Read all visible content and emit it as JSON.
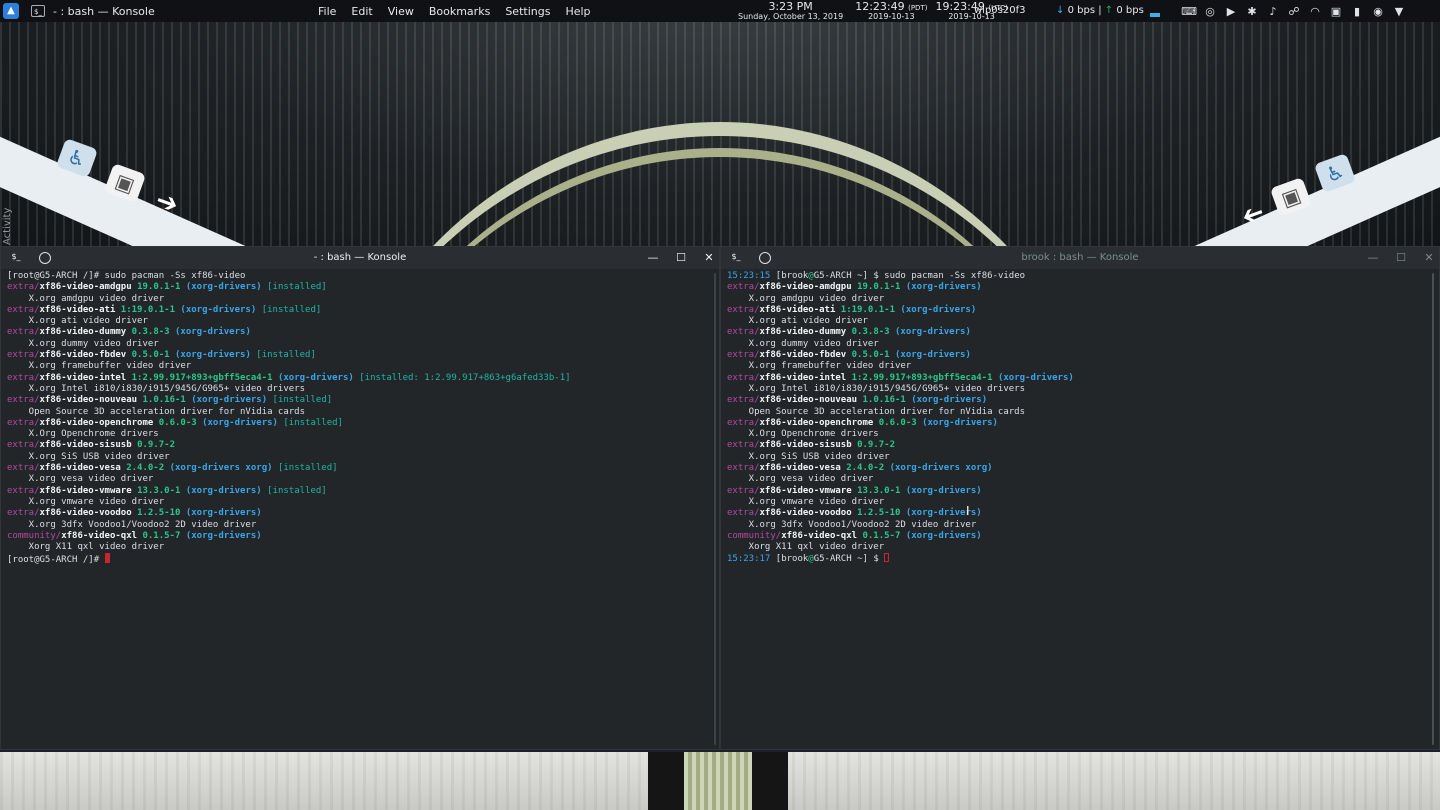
{
  "top_panel": {
    "launcher_icon": "app-launcher-icon",
    "task_title": "- : bash — Konsole",
    "menu": [
      "File",
      "Edit",
      "View",
      "Bookmarks",
      "Settings",
      "Help"
    ],
    "clock_local": {
      "time": "3:23 PM",
      "date": "Sunday, October 13, 2019"
    },
    "clock_pdt": {
      "time": "12:23:49",
      "tz": "(PDT)",
      "date": "2019-10-13"
    },
    "clock_utc": {
      "time": "19:23:49",
      "tz": "(UTC)",
      "date": "2019-10-13"
    },
    "network_interface": "wlp0s20f3",
    "net_down_arrow": "↓",
    "net_down": "0 bps",
    "net_sep": "|",
    "net_up_arrow": "↑",
    "net_up": "0 bps",
    "tray_icons": [
      "keyboard-icon",
      "clipboard-icon",
      "media-player-icon",
      "bluetooth-icon",
      "volume-icon",
      "kde-connect-icon",
      "wifi-icon",
      "lock-icon",
      "battery-icon",
      "notifications-icon",
      "arrow-down-icon"
    ]
  },
  "activity_label": "Activity",
  "left_window": {
    "title": "- : bash — Konsole",
    "lines": [
      [
        [
          "t-plain",
          "[root@G5-ARCH /]# sudo pacman -Ss xf86-video"
        ]
      ],
      [
        [
          "t-repo",
          "extra/"
        ],
        [
          "t-pkg",
          "xf86-video-amdgpu"
        ],
        [
          "t-plain",
          " "
        ],
        [
          "t-ver",
          "19.0.1-1"
        ],
        [
          "t-plain",
          " "
        ],
        [
          "t-grp",
          "(xorg-drivers)"
        ],
        [
          "t-plain",
          " "
        ],
        [
          "t-inst",
          "[installed]"
        ]
      ],
      [
        [
          "t-plain",
          "    X.org amdgpu video driver"
        ]
      ],
      [
        [
          "t-repo",
          "extra/"
        ],
        [
          "t-pkg",
          "xf86-video-ati"
        ],
        [
          "t-plain",
          " "
        ],
        [
          "t-ver",
          "1:19.0.1-1"
        ],
        [
          "t-plain",
          " "
        ],
        [
          "t-grp",
          "(xorg-drivers)"
        ],
        [
          "t-plain",
          " "
        ],
        [
          "t-inst",
          "[installed]"
        ]
      ],
      [
        [
          "t-plain",
          "    X.org ati video driver"
        ]
      ],
      [
        [
          "t-repo",
          "extra/"
        ],
        [
          "t-pkg",
          "xf86-video-dummy"
        ],
        [
          "t-plain",
          " "
        ],
        [
          "t-ver",
          "0.3.8-3"
        ],
        [
          "t-plain",
          " "
        ],
        [
          "t-grp",
          "(xorg-drivers)"
        ]
      ],
      [
        [
          "t-plain",
          "    X.org dummy video driver"
        ]
      ],
      [
        [
          "t-repo",
          "extra/"
        ],
        [
          "t-pkg",
          "xf86-video-fbdev"
        ],
        [
          "t-plain",
          " "
        ],
        [
          "t-ver",
          "0.5.0-1"
        ],
        [
          "t-plain",
          " "
        ],
        [
          "t-grp",
          "(xorg-drivers)"
        ],
        [
          "t-plain",
          " "
        ],
        [
          "t-inst",
          "[installed]"
        ]
      ],
      [
        [
          "t-plain",
          "    X.org framebuffer video driver"
        ]
      ],
      [
        [
          "t-repo",
          "extra/"
        ],
        [
          "t-pkg",
          "xf86-video-intel"
        ],
        [
          "t-plain",
          " "
        ],
        [
          "t-ver",
          "1:2.99.917+893+gbff5eca4-1"
        ],
        [
          "t-plain",
          " "
        ],
        [
          "t-grp",
          "(xorg-drivers)"
        ],
        [
          "t-plain",
          " "
        ],
        [
          "t-inst",
          "[installed: 1:2.99.917+863+g6afed33b-1]"
        ]
      ],
      [
        [
          "t-plain",
          "    X.org Intel i810/i830/i915/945G/G965+ video drivers"
        ]
      ],
      [
        [
          "t-repo",
          "extra/"
        ],
        [
          "t-pkg",
          "xf86-video-nouveau"
        ],
        [
          "t-plain",
          " "
        ],
        [
          "t-ver",
          "1.0.16-1"
        ],
        [
          "t-plain",
          " "
        ],
        [
          "t-grp",
          "(xorg-drivers)"
        ],
        [
          "t-plain",
          " "
        ],
        [
          "t-inst",
          "[installed]"
        ]
      ],
      [
        [
          "t-plain",
          "    Open Source 3D acceleration driver for nVidia cards"
        ]
      ],
      [
        [
          "t-repo",
          "extra/"
        ],
        [
          "t-pkg",
          "xf86-video-openchrome"
        ],
        [
          "t-plain",
          " "
        ],
        [
          "t-ver",
          "0.6.0-3"
        ],
        [
          "t-plain",
          " "
        ],
        [
          "t-grp",
          "(xorg-drivers)"
        ],
        [
          "t-plain",
          " "
        ],
        [
          "t-inst",
          "[installed]"
        ]
      ],
      [
        [
          "t-plain",
          "    X.Org Openchrome drivers"
        ]
      ],
      [
        [
          "t-repo",
          "extra/"
        ],
        [
          "t-pkg",
          "xf86-video-sisusb"
        ],
        [
          "t-plain",
          " "
        ],
        [
          "t-ver",
          "0.9.7-2"
        ]
      ],
      [
        [
          "t-plain",
          "    X.org SiS USB video driver"
        ]
      ],
      [
        [
          "t-repo",
          "extra/"
        ],
        [
          "t-pkg",
          "xf86-video-vesa"
        ],
        [
          "t-plain",
          " "
        ],
        [
          "t-ver",
          "2.4.0-2"
        ],
        [
          "t-plain",
          " "
        ],
        [
          "t-grp",
          "(xorg-drivers xorg)"
        ],
        [
          "t-plain",
          " "
        ],
        [
          "t-inst",
          "[installed]"
        ]
      ],
      [
        [
          "t-plain",
          "    X.org vesa video driver"
        ]
      ],
      [
        [
          "t-repo",
          "extra/"
        ],
        [
          "t-pkg",
          "xf86-video-vmware"
        ],
        [
          "t-plain",
          " "
        ],
        [
          "t-ver",
          "13.3.0-1"
        ],
        [
          "t-plain",
          " "
        ],
        [
          "t-grp",
          "(xorg-drivers)"
        ],
        [
          "t-plain",
          " "
        ],
        [
          "t-inst",
          "[installed]"
        ]
      ],
      [
        [
          "t-plain",
          "    X.org vmware video driver"
        ]
      ],
      [
        [
          "t-repo",
          "extra/"
        ],
        [
          "t-pkg",
          "xf86-video-voodoo"
        ],
        [
          "t-plain",
          " "
        ],
        [
          "t-ver",
          "1.2.5-10"
        ],
        [
          "t-plain",
          " "
        ],
        [
          "t-grp",
          "(xorg-drivers)"
        ]
      ],
      [
        [
          "t-plain",
          "    X.org 3dfx Voodoo1/Voodoo2 2D video driver"
        ]
      ],
      [
        [
          "t-repo-com",
          "community/"
        ],
        [
          "t-pkg",
          "xf86-video-qxl"
        ],
        [
          "t-plain",
          " "
        ],
        [
          "t-ver",
          "0.1.5-7"
        ],
        [
          "t-plain",
          " "
        ],
        [
          "t-grp",
          "(xorg-drivers)"
        ]
      ],
      [
        [
          "t-plain",
          "    Xorg X11 qxl video driver"
        ]
      ],
      [
        [
          "t-plain",
          "[root@G5-ARCH /]# "
        ],
        [
          "cursor-block",
          ""
        ]
      ]
    ]
  },
  "right_window": {
    "title": "brook : bash — Konsole",
    "lines": [
      [
        [
          "t-time",
          "15:23:15"
        ],
        [
          "t-plain",
          " [brook"
        ],
        [
          "t-at",
          "@"
        ],
        [
          "t-plain",
          "G5-ARCH ~] $ sudo pacman -Ss xf86-video"
        ]
      ],
      [
        [
          "t-repo",
          "extra/"
        ],
        [
          "t-pkg",
          "xf86-video-amdgpu"
        ],
        [
          "t-plain",
          " "
        ],
        [
          "t-ver",
          "19.0.1-1"
        ],
        [
          "t-plain",
          " "
        ],
        [
          "t-grp",
          "(xorg-drivers)"
        ]
      ],
      [
        [
          "t-plain",
          "    X.org amdgpu video driver"
        ]
      ],
      [
        [
          "t-repo",
          "extra/"
        ],
        [
          "t-pkg",
          "xf86-video-ati"
        ],
        [
          "t-plain",
          " "
        ],
        [
          "t-ver",
          "1:19.0.1-1"
        ],
        [
          "t-plain",
          " "
        ],
        [
          "t-grp",
          "(xorg-drivers)"
        ]
      ],
      [
        [
          "t-plain",
          "    X.org ati video driver"
        ]
      ],
      [
        [
          "t-repo",
          "extra/"
        ],
        [
          "t-pkg",
          "xf86-video-dummy"
        ],
        [
          "t-plain",
          " "
        ],
        [
          "t-ver",
          "0.3.8-3"
        ],
        [
          "t-plain",
          " "
        ],
        [
          "t-grp",
          "(xorg-drivers)"
        ]
      ],
      [
        [
          "t-plain",
          "    X.org dummy video driver"
        ]
      ],
      [
        [
          "t-repo",
          "extra/"
        ],
        [
          "t-pkg",
          "xf86-video-fbdev"
        ],
        [
          "t-plain",
          " "
        ],
        [
          "t-ver",
          "0.5.0-1"
        ],
        [
          "t-plain",
          " "
        ],
        [
          "t-grp",
          "(xorg-drivers)"
        ]
      ],
      [
        [
          "t-plain",
          "    X.org framebuffer video driver"
        ]
      ],
      [
        [
          "t-repo",
          "extra/"
        ],
        [
          "t-pkg",
          "xf86-video-intel"
        ],
        [
          "t-plain",
          " "
        ],
        [
          "t-ver",
          "1:2.99.917+893+gbff5eca4-1"
        ],
        [
          "t-plain",
          " "
        ],
        [
          "t-grp",
          "(xorg-drivers)"
        ]
      ],
      [
        [
          "t-plain",
          "    X.org Intel i810/i830/i915/945G/G965+ video drivers"
        ]
      ],
      [
        [
          "t-repo",
          "extra/"
        ],
        [
          "t-pkg",
          "xf86-video-nouveau"
        ],
        [
          "t-plain",
          " "
        ],
        [
          "t-ver",
          "1.0.16-1"
        ],
        [
          "t-plain",
          " "
        ],
        [
          "t-grp",
          "(xorg-drivers)"
        ]
      ],
      [
        [
          "t-plain",
          "    Open Source 3D acceleration driver for nVidia cards"
        ]
      ],
      [
        [
          "t-repo",
          "extra/"
        ],
        [
          "t-pkg",
          "xf86-video-openchrome"
        ],
        [
          "t-plain",
          " "
        ],
        [
          "t-ver",
          "0.6.0-3"
        ],
        [
          "t-plain",
          " "
        ],
        [
          "t-grp",
          "(xorg-drivers)"
        ]
      ],
      [
        [
          "t-plain",
          "    X.Org Openchrome drivers"
        ]
      ],
      [
        [
          "t-repo",
          "extra/"
        ],
        [
          "t-pkg",
          "xf86-video-sisusb"
        ],
        [
          "t-plain",
          " "
        ],
        [
          "t-ver",
          "0.9.7-2"
        ]
      ],
      [
        [
          "t-plain",
          "    X.org SiS USB video driver"
        ]
      ],
      [
        [
          "t-repo",
          "extra/"
        ],
        [
          "t-pkg",
          "xf86-video-vesa"
        ],
        [
          "t-plain",
          " "
        ],
        [
          "t-ver",
          "2.4.0-2"
        ],
        [
          "t-plain",
          " "
        ],
        [
          "t-grp",
          "(xorg-drivers xorg)"
        ]
      ],
      [
        [
          "t-plain",
          "    X.org vesa video driver"
        ]
      ],
      [
        [
          "t-repo",
          "extra/"
        ],
        [
          "t-pkg",
          "xf86-video-vmware"
        ],
        [
          "t-plain",
          " "
        ],
        [
          "t-ver",
          "13.3.0-1"
        ],
        [
          "t-plain",
          " "
        ],
        [
          "t-grp",
          "(xorg-drivers)"
        ]
      ],
      [
        [
          "t-plain",
          "    X.org vmware video driver"
        ]
      ],
      [
        [
          "t-repo",
          "extra/"
        ],
        [
          "t-pkg",
          "xf86-video-voodoo"
        ],
        [
          "t-plain",
          " "
        ],
        [
          "t-ver",
          "1.2.5-10"
        ],
        [
          "t-plain",
          " "
        ],
        [
          "t-grp",
          "(xorg-drivers)"
        ]
      ],
      [
        [
          "t-plain",
          "    X.org 3dfx Voodoo1/Voodoo2 2D video driver"
        ]
      ],
      [
        [
          "t-repo-com",
          "community/"
        ],
        [
          "t-pkg",
          "xf86-video-qxl"
        ],
        [
          "t-plain",
          " "
        ],
        [
          "t-ver",
          "0.1.5-7"
        ],
        [
          "t-plain",
          " "
        ],
        [
          "t-grp",
          "(xorg-drivers)"
        ]
      ],
      [
        [
          "t-plain",
          "    Xorg X11 qxl video driver"
        ]
      ],
      [
        [
          "t-time",
          "15:23:17"
        ],
        [
          "t-plain",
          " [brook"
        ],
        [
          "t-at",
          "@"
        ],
        [
          "t-plain",
          "G5-ARCH ~] $ "
        ],
        [
          "cursor-hollow",
          ""
        ]
      ]
    ]
  }
}
